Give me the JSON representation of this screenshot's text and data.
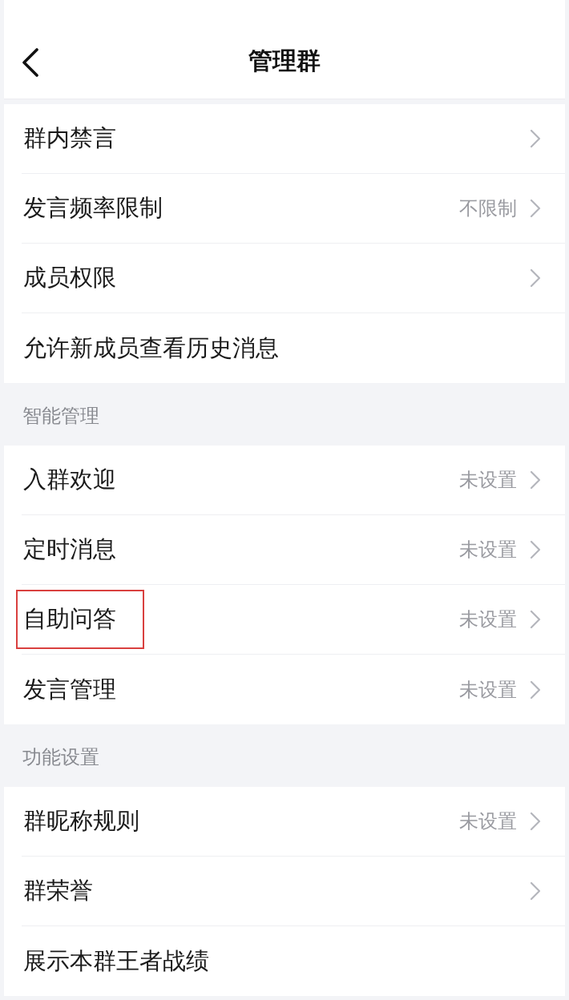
{
  "header": {
    "title": "管理群"
  },
  "sections": [
    {
      "items": [
        {
          "kind": "link",
          "label": "群内禁言",
          "highlighted": false
        },
        {
          "kind": "link",
          "label": "发言频率限制",
          "value": "不限制",
          "highlighted": false
        },
        {
          "kind": "link",
          "label": "成员权限",
          "highlighted": false
        },
        {
          "kind": "plain",
          "label": "允许新成员查看历史消息",
          "highlighted": false
        }
      ]
    },
    {
      "title": "智能管理",
      "items": [
        {
          "kind": "link",
          "label": "入群欢迎",
          "value": "未设置",
          "highlighted": false
        },
        {
          "kind": "link",
          "label": "定时消息",
          "value": "未设置",
          "highlighted": false
        },
        {
          "kind": "link",
          "label": "自助问答",
          "value": "未设置",
          "highlighted": true
        },
        {
          "kind": "link",
          "label": "发言管理",
          "value": "未设置",
          "highlighted": false
        }
      ]
    },
    {
      "title": "功能设置",
      "items": [
        {
          "kind": "link",
          "label": "群昵称规则",
          "value": "未设置",
          "highlighted": false
        },
        {
          "kind": "link",
          "label": "群荣誉",
          "highlighted": false
        },
        {
          "kind": "plain",
          "label": "展示本群王者战绩",
          "highlighted": false
        }
      ]
    }
  ]
}
